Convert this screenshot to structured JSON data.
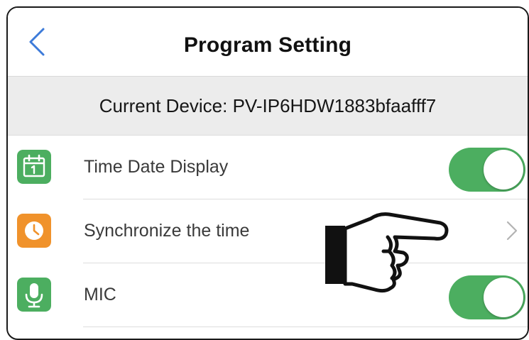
{
  "header": {
    "title": "Program Setting",
    "back_icon": "chevron-left-icon"
  },
  "device": {
    "label": "Current Device: PV-IP6HDW1883bfaafff7"
  },
  "settings": [
    {
      "label": "Time Date Display",
      "icon": "calendar-icon",
      "icon_color": "#4cae60",
      "control": "toggle",
      "enabled": true
    },
    {
      "label": "Synchronize the time",
      "icon": "clock-icon",
      "icon_color": "#f0922b",
      "control": "chevron"
    },
    {
      "label": "MIC",
      "icon": "microphone-icon",
      "icon_color": "#4cae60",
      "control": "toggle",
      "enabled": true
    }
  ],
  "annotation": {
    "icon": "pointing-hand-icon"
  },
  "colors": {
    "accent_green": "#4cae60",
    "accent_orange": "#f0922b",
    "back_blue": "#3d7bd9"
  }
}
